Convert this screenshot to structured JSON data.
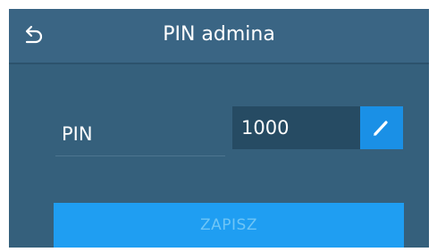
{
  "header": {
    "title": "PIN admina",
    "back_icon": "undo-arrow-icon"
  },
  "form": {
    "pin_label": "PIN",
    "pin_value": "1000",
    "edit_icon": "pencil-icon"
  },
  "actions": {
    "save_label": "ZAPISZ",
    "save_enabled": false
  },
  "colors": {
    "panel": "#3e6784",
    "value_box": "#264b63",
    "accent": "#1a90e6",
    "save_button": "#1f9ef2",
    "save_text_disabled": "#6ec5f6"
  }
}
